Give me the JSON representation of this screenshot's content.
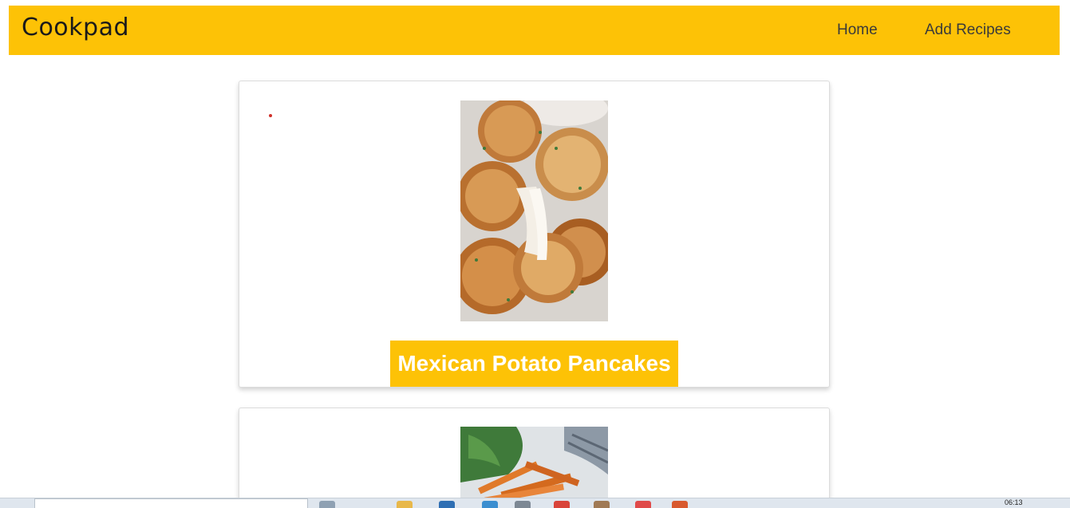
{
  "navbar": {
    "brand": "Cookpad",
    "links": [
      {
        "label": "Home"
      },
      {
        "label": "Add Recipes"
      }
    ]
  },
  "recipes": [
    {
      "title": "Mexican Potato Pancakes",
      "image": "potato-pancakes-photo"
    },
    {
      "title": "",
      "image": "sweet-potato-fries-photo"
    }
  ],
  "taskbar": {
    "clock": "06:13"
  },
  "colors": {
    "accent": "#fdc206",
    "title_text": "#ffffff"
  }
}
